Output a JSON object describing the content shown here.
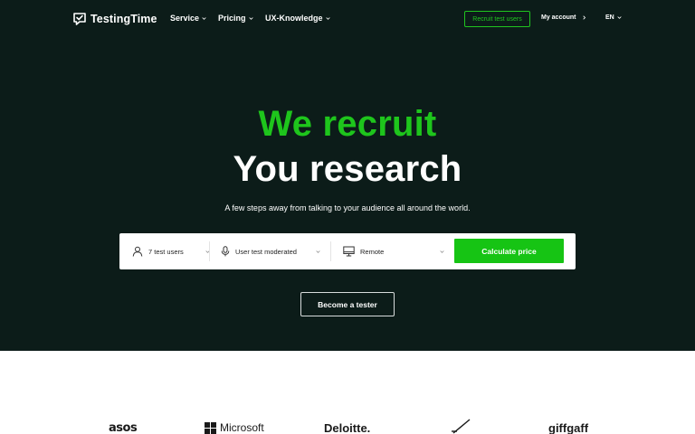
{
  "brand": {
    "name": "TestingTime"
  },
  "nav": {
    "items": [
      {
        "label": "Service"
      },
      {
        "label": "Pricing"
      },
      {
        "label": "UX-Knowledge"
      }
    ],
    "recruit_label": "Recruit test users",
    "account_label": "My account",
    "language": "EN"
  },
  "hero": {
    "headline_green": "We recruit",
    "headline_white": "You research",
    "subtitle": "A few steps away from talking to your audience all around the world."
  },
  "search": {
    "users": {
      "value": "7 test users",
      "icon": "person-icon"
    },
    "test_type": {
      "value": "User test moderated",
      "icon": "microphone-icon"
    },
    "mode": {
      "value": "Remote",
      "icon": "monitor-icon"
    },
    "cta_label": "Calculate price"
  },
  "tester_label": "Become a tester",
  "logos": {
    "items": [
      "asos",
      "Microsoft",
      "Deloitte.",
      "giffgaff"
    ]
  },
  "colors": {
    "hero_bg": "#0c1c19",
    "accent": "#1ec51c",
    "text_on_dark": "#ffffff"
  }
}
